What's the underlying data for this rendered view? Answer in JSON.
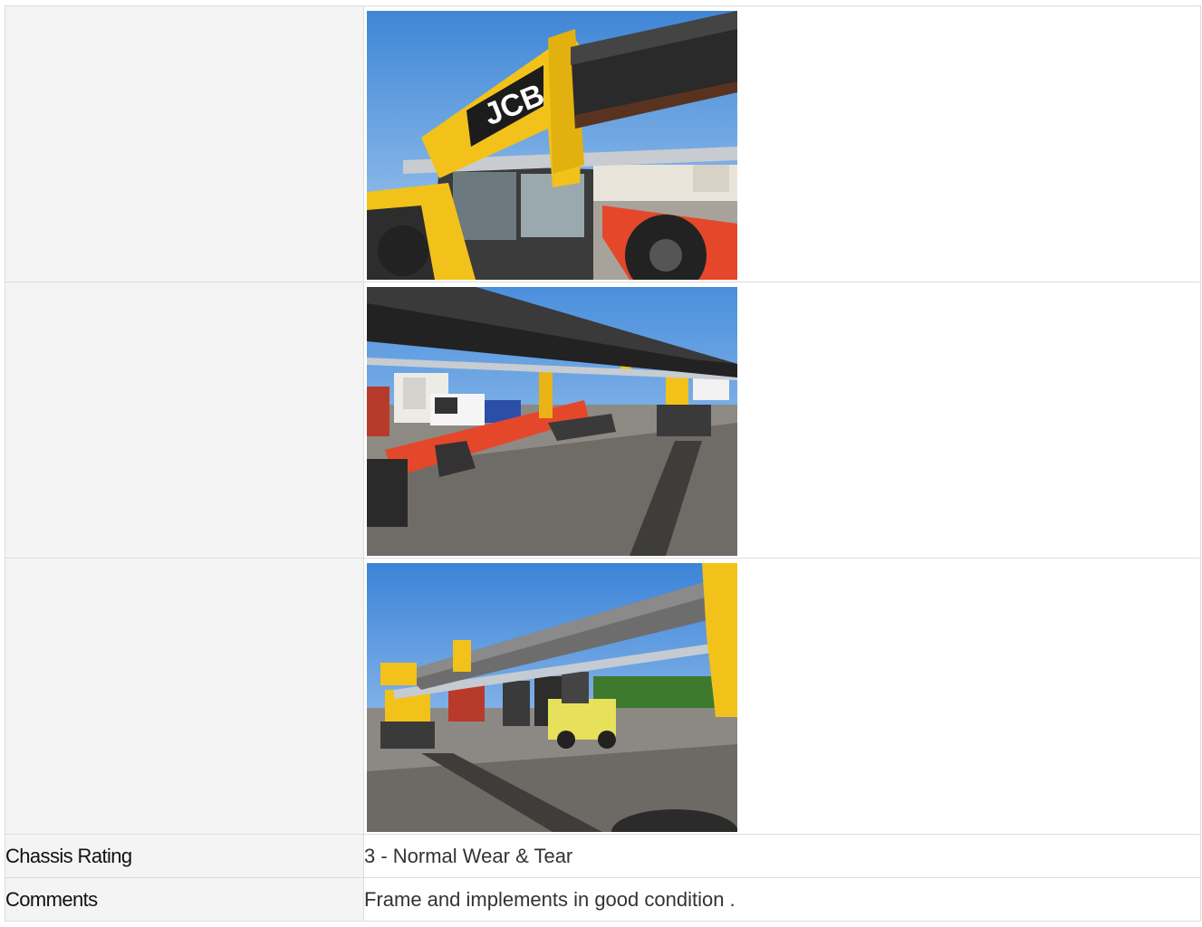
{
  "rows": {
    "photos": [
      {
        "label": "",
        "photo": "telehandler-boom-jcb-cab-photo"
      },
      {
        "label": "",
        "photo": "telehandler-boom-over-yard-photo"
      },
      {
        "label": "",
        "photo": "telehandler-boom-forklifts-photo"
      }
    ],
    "chassis_rating": {
      "label": "Chassis Rating",
      "value": "3 - Normal Wear & Tear"
    },
    "comments": {
      "label": "Comments",
      "value": "Frame and implements in good condition ."
    }
  },
  "colors": {
    "label_bg": "#f4f4f4",
    "border": "#dcdcdc",
    "jcb_yellow": "#f2c21b",
    "sky": "#5b9be0"
  }
}
